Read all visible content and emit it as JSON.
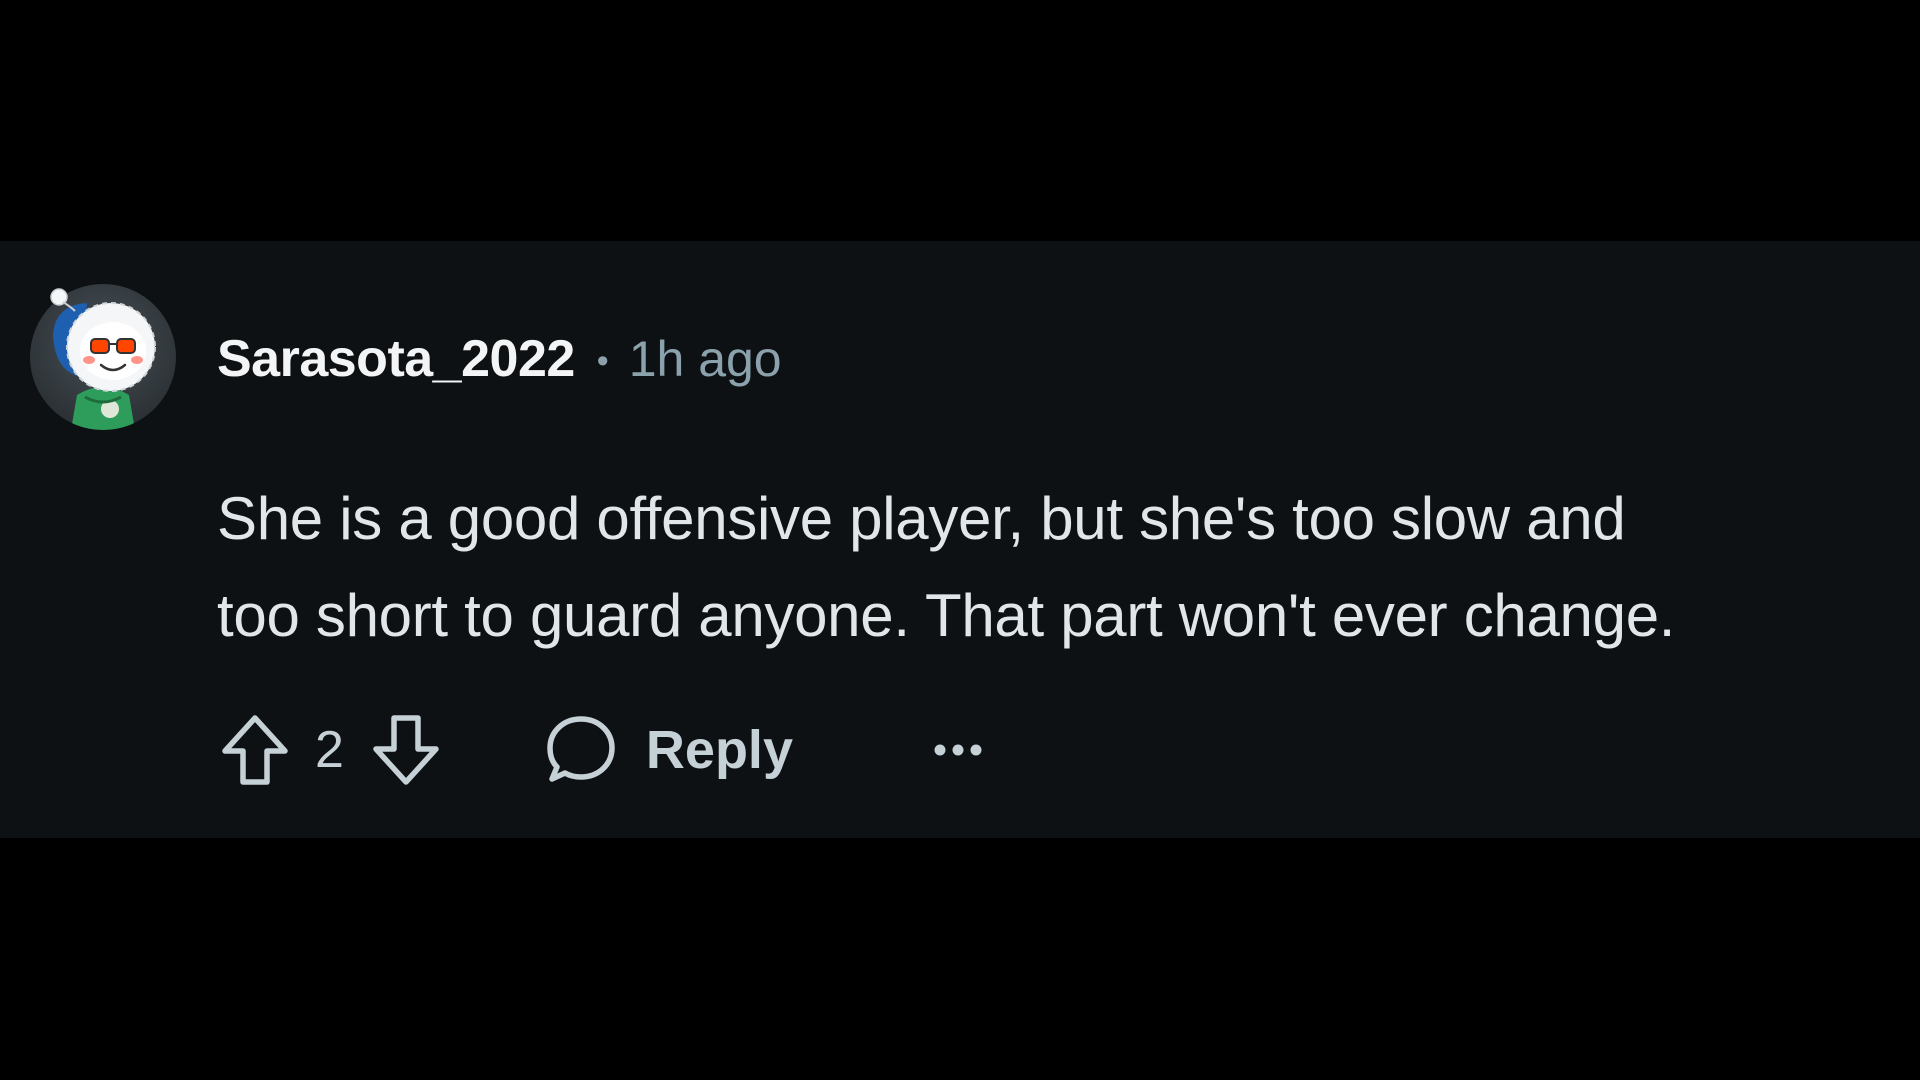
{
  "comment": {
    "username": "Sarasota_2022",
    "separator": "•",
    "time_ago": "1h ago",
    "body_lines": [
      "She is a good offensive player, but she's too slow and",
      "too short to guard anyone. That part won't ever change."
    ],
    "vote_count": "2",
    "reply_label": "Reply"
  },
  "icons": {
    "avatar": "snoo-avatar-icon",
    "upvote": "upvote-arrow-icon",
    "downvote": "downvote-arrow-icon",
    "reply": "speech-bubble-icon",
    "more": "ellipsis-icon"
  },
  "colors": {
    "page_background": "#000000",
    "card_background": "#0e1113",
    "username": "#f2f4f5",
    "meta_text": "#8ba2ad",
    "body_text": "#e0e6e9",
    "action_text": "#c5d1d6"
  }
}
